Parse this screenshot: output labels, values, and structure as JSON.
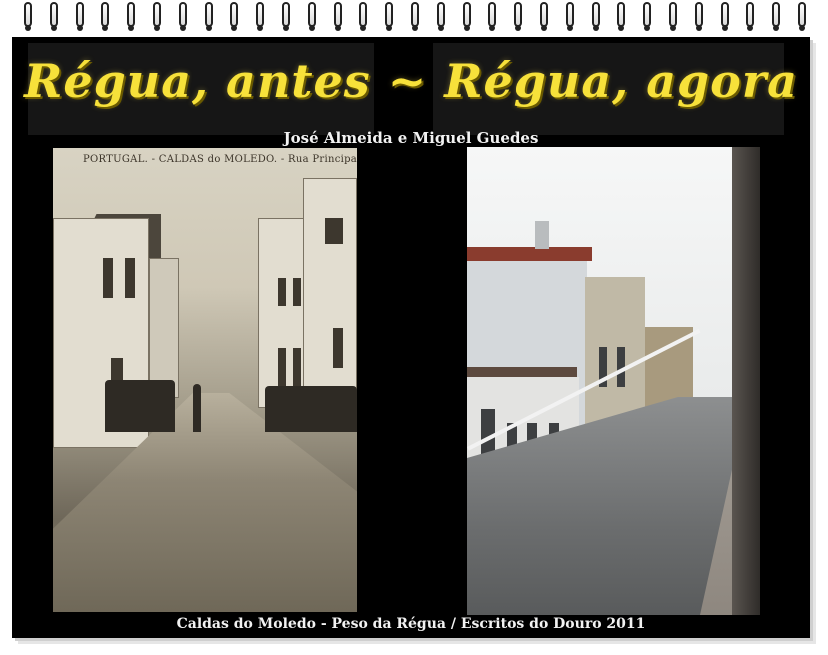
{
  "poster": {
    "title": "Régua, antes ~ Régua, agora",
    "authors": "José Almeida e Miguel Guedes",
    "footer": "Caldas do Moledo - Peso da Régua / Escritos do Douro 2011"
  },
  "photo_old": {
    "caption": "PORTUGAL. - CALDAS do MOLEDO. - Rua Principal"
  },
  "colors": {
    "title": "#f7e13a",
    "panel": "#000000",
    "text": "#f2f2f2"
  }
}
